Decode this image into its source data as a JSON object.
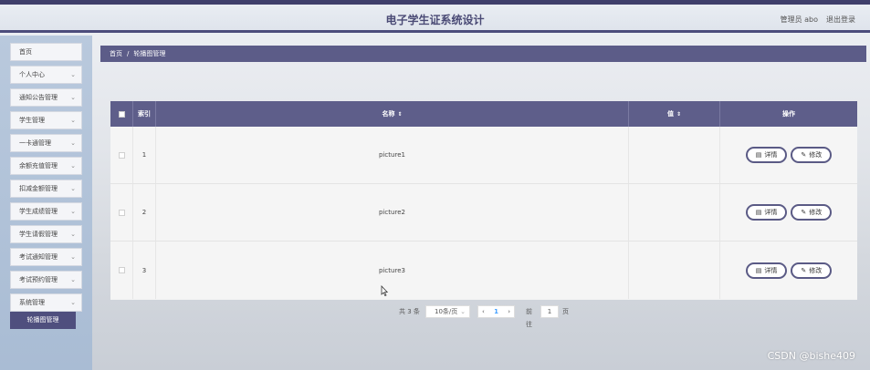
{
  "header": {
    "title": "电子学生证系统设计",
    "user": "管理员 abo",
    "logout": "退出登录"
  },
  "sidebar": {
    "items": [
      {
        "label": "首页",
        "has_chevron": false
      },
      {
        "label": "个人中心",
        "has_chevron": true
      },
      {
        "label": "通知公告管理",
        "has_chevron": true
      },
      {
        "label": "学生管理",
        "has_chevron": true
      },
      {
        "label": "一卡通管理",
        "has_chevron": true
      },
      {
        "label": "余额充值管理",
        "has_chevron": true
      },
      {
        "label": "扣减金额管理",
        "has_chevron": true
      },
      {
        "label": "学生成绩管理",
        "has_chevron": true
      },
      {
        "label": "学生请假管理",
        "has_chevron": true
      },
      {
        "label": "考试通知管理",
        "has_chevron": true
      },
      {
        "label": "考试预约管理",
        "has_chevron": true
      },
      {
        "label": "系统管理",
        "has_chevron": true
      }
    ],
    "active_sub": "轮播图管理"
  },
  "breadcrumb": {
    "home": "首页",
    "separator": "/",
    "current": "轮播图管理"
  },
  "table": {
    "columns": {
      "index": "索引",
      "name": "名称",
      "value": "值",
      "actions": "操作"
    },
    "rows": [
      {
        "index": "1",
        "name": "picture1",
        "value": ""
      },
      {
        "index": "2",
        "name": "picture2",
        "value": ""
      },
      {
        "index": "3",
        "name": "picture3",
        "value": ""
      }
    ],
    "detail_label": "详情",
    "edit_label": "修改"
  },
  "pagination": {
    "total": "共 3 条",
    "page_size": "10条/页",
    "current_page": "1",
    "goto_label": "前往",
    "goto_value": "1",
    "page_word": "页"
  },
  "watermark": "CSDN @bishe409",
  "colors": {
    "accent": "#5e5e8a",
    "header_border": "#4d4d7c",
    "sidebar": "#b0c2d8",
    "active_menu": "#4f4f7e"
  }
}
